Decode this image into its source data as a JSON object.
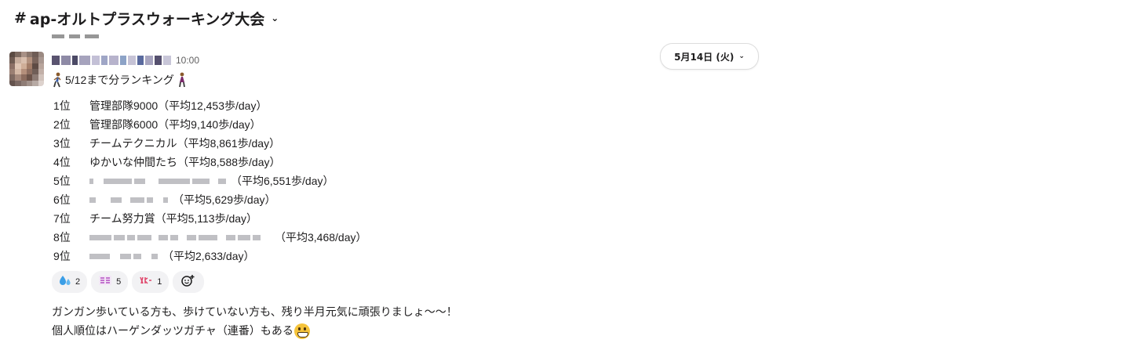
{
  "channel": {
    "hash": "#",
    "name": "ap-オルトプラスウォーキング大会",
    "chevron": "⌄"
  },
  "date_divider": {
    "label": "5月14日 (火)",
    "chevron": "⌄"
  },
  "message": {
    "timestamp": "10:00",
    "headline": "5/12まで分ランキング",
    "rankings": [
      {
        "pos": "1位",
        "team": "管理部隊9000",
        "avg": "（平均12,453歩/day）"
      },
      {
        "pos": "2位",
        "team": "管理部隊6000",
        "avg": "（平均9,140歩/day）"
      },
      {
        "pos": "3位",
        "team": "チームテクニカル",
        "avg": "（平均8,861歩/day）"
      },
      {
        "pos": "4位",
        "team": "ゆかいな仲間たち",
        "avg": "（平均8,588歩/day）"
      },
      {
        "pos": "5位",
        "team": "",
        "avg": "（平均6,551歩/day）"
      },
      {
        "pos": "6位",
        "team": "",
        "avg": "（平均5,629歩/day）"
      },
      {
        "pos": "7位",
        "team": "チーム努力賞",
        "avg": "（平均5,113歩/day）"
      },
      {
        "pos": "8位",
        "team": "",
        "avg": "（平均3,468/day）"
      },
      {
        "pos": "9位",
        "team": "",
        "avg": "（平均2,633/day）"
      }
    ],
    "reactions": [
      {
        "icon": "sweat-drops-icon",
        "count": "2"
      },
      {
        "icon": "custom-stamp-icon",
        "count": "5"
      },
      {
        "icon": "power-stamp-icon",
        "count": "1"
      }
    ],
    "footer_lines": [
      "ガンガン歩いている方も、歩けていない方も、残り半月元気に頑張りましょ〜〜！",
      "個人順位はハーゲンダッツガチャ（連番）もある"
    ]
  }
}
